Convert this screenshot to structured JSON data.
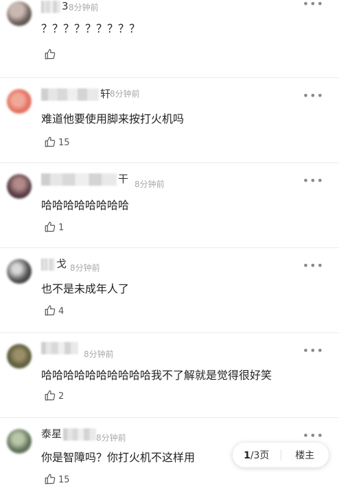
{
  "comments": [
    {
      "user_visible": "3",
      "time": "8分钟前",
      "text": "？？？？？？？？？",
      "likes": ""
    },
    {
      "user_visible": "轩",
      "time": "8分钟前",
      "text": "难道他要使用脚来按打火机吗",
      "likes": "15"
    },
    {
      "user_visible": "干",
      "time": "8分钟前",
      "text": "哈哈哈哈哈哈哈哈",
      "likes": "1"
    },
    {
      "user_visible": "戈",
      "time": "8分钟前",
      "text": "也不是未成年人了",
      "likes": "4"
    },
    {
      "user_visible": "",
      "time": "8分钟前",
      "text": "哈哈哈哈哈哈哈哈哈哈我不了解就是觉得很好笑",
      "likes": "2"
    },
    {
      "user_visible": "泰星",
      "time": "8分钟前",
      "text": "你是智障吗？你打火机不这样用",
      "likes": "15"
    }
  ],
  "more_label": "•••",
  "pager": {
    "current": "1",
    "rest": "/3页",
    "op_label": "楼主"
  },
  "icons": {
    "like": "thumbs-up-icon",
    "more": "more-dots-icon"
  }
}
